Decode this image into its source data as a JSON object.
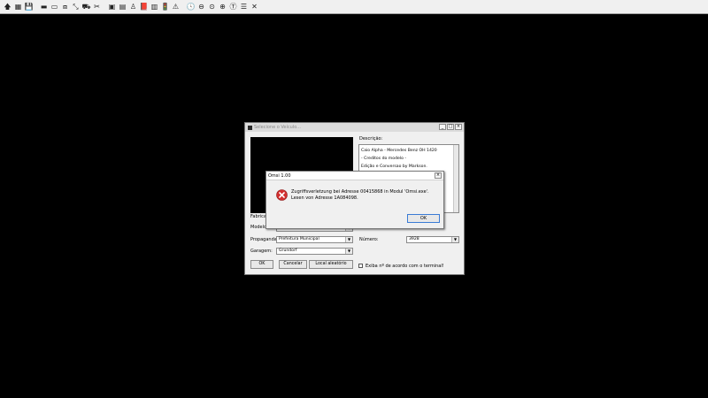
{
  "toolbar": {
    "buttons": [
      {
        "name": "arrow-up-icon",
        "glyph": "🡅"
      },
      {
        "name": "map-icon",
        "glyph": "▦"
      },
      {
        "name": "save-icon",
        "glyph": "💾"
      },
      {
        "name": "bus-black-icon",
        "glyph": "▬"
      },
      {
        "name": "bus-double-icon",
        "glyph": "▭"
      },
      {
        "name": "road-icon",
        "glyph": "⧈"
      },
      {
        "name": "tool-icon",
        "glyph": "⤡"
      },
      {
        "name": "vehicle-icon",
        "glyph": "⛟"
      },
      {
        "name": "scissors-icon",
        "glyph": "✂"
      },
      {
        "name": "gray-box-icon",
        "glyph": "▣"
      },
      {
        "name": "gray-tile-icon",
        "glyph": "▤"
      },
      {
        "name": "figure-icon",
        "glyph": "♙"
      },
      {
        "name": "book-icon",
        "glyph": "📕"
      },
      {
        "name": "document-icon",
        "glyph": "▥"
      },
      {
        "name": "signal-icon",
        "glyph": "🚦"
      },
      {
        "name": "warning-icon",
        "glyph": "⚠"
      },
      {
        "name": "clock-icon",
        "glyph": "🕓"
      },
      {
        "name": "minus-icon",
        "glyph": "⊖"
      },
      {
        "name": "circle-icon",
        "glyph": "⊙"
      },
      {
        "name": "plus-sign-icon",
        "glyph": "⊕"
      },
      {
        "name": "text-icon",
        "glyph": "Ⓣ"
      },
      {
        "name": "lines-icon",
        "glyph": "☰"
      },
      {
        "name": "close-x-icon",
        "glyph": "✕"
      }
    ]
  },
  "vehicle_window": {
    "title": "Selecione o Veículo...",
    "description_label": "Descrição:",
    "description_lines": [
      "Caio Alpha - Mercedes Benz OH 1420",
      "- Creditos do modelo -",
      "Edição e Conversao by Markson."
    ],
    "fabricante_label": "Fabricant",
    "modelo_label": "Modelo:",
    "modelo_value": "",
    "propaganda_label": "Propaganda:",
    "propaganda_value": "Prefeitura Municipal",
    "garagem_label": "Garagem:",
    "garagem_value": "Grundorf",
    "numero_label": "Número:",
    "numero_value": "3928",
    "ok_label": "OK",
    "cancel_label": "Cancelar",
    "random_label": "Local aleatório",
    "checkbox_label": "Exiba nº de acordo com o terminal!"
  },
  "error_dialog": {
    "title": "Omsi 1.00",
    "message": "Zugriffsverletzung bei Adresse 00415868 in Modul 'Omsi.exe'. Lesen von Adresse 1A084098.",
    "ok_label": "OK"
  },
  "colors": {
    "background": "#000000",
    "error_red": "#d32f2f",
    "focus_blue": "#3a7bd5"
  }
}
